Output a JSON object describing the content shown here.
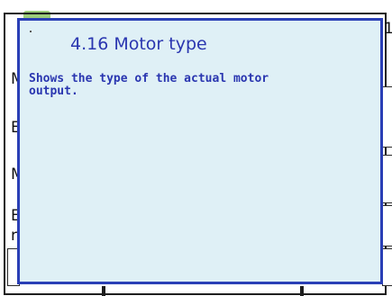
{
  "background": {
    "fragments": {
      "top_right": "1",
      "left_1": "M",
      "left_2": "E",
      "left_3": "M",
      "left_4": "E",
      "left_5": "r"
    }
  },
  "help_popup": {
    "title": "4.16 Motor type",
    "body": "Shows the type of the actual motor\noutput."
  },
  "colors": {
    "popup_background": "#dff0f6",
    "popup_border": "#2a3fb6",
    "popup_text": "#2a36b0",
    "green_tab": "#9ccc7a"
  }
}
